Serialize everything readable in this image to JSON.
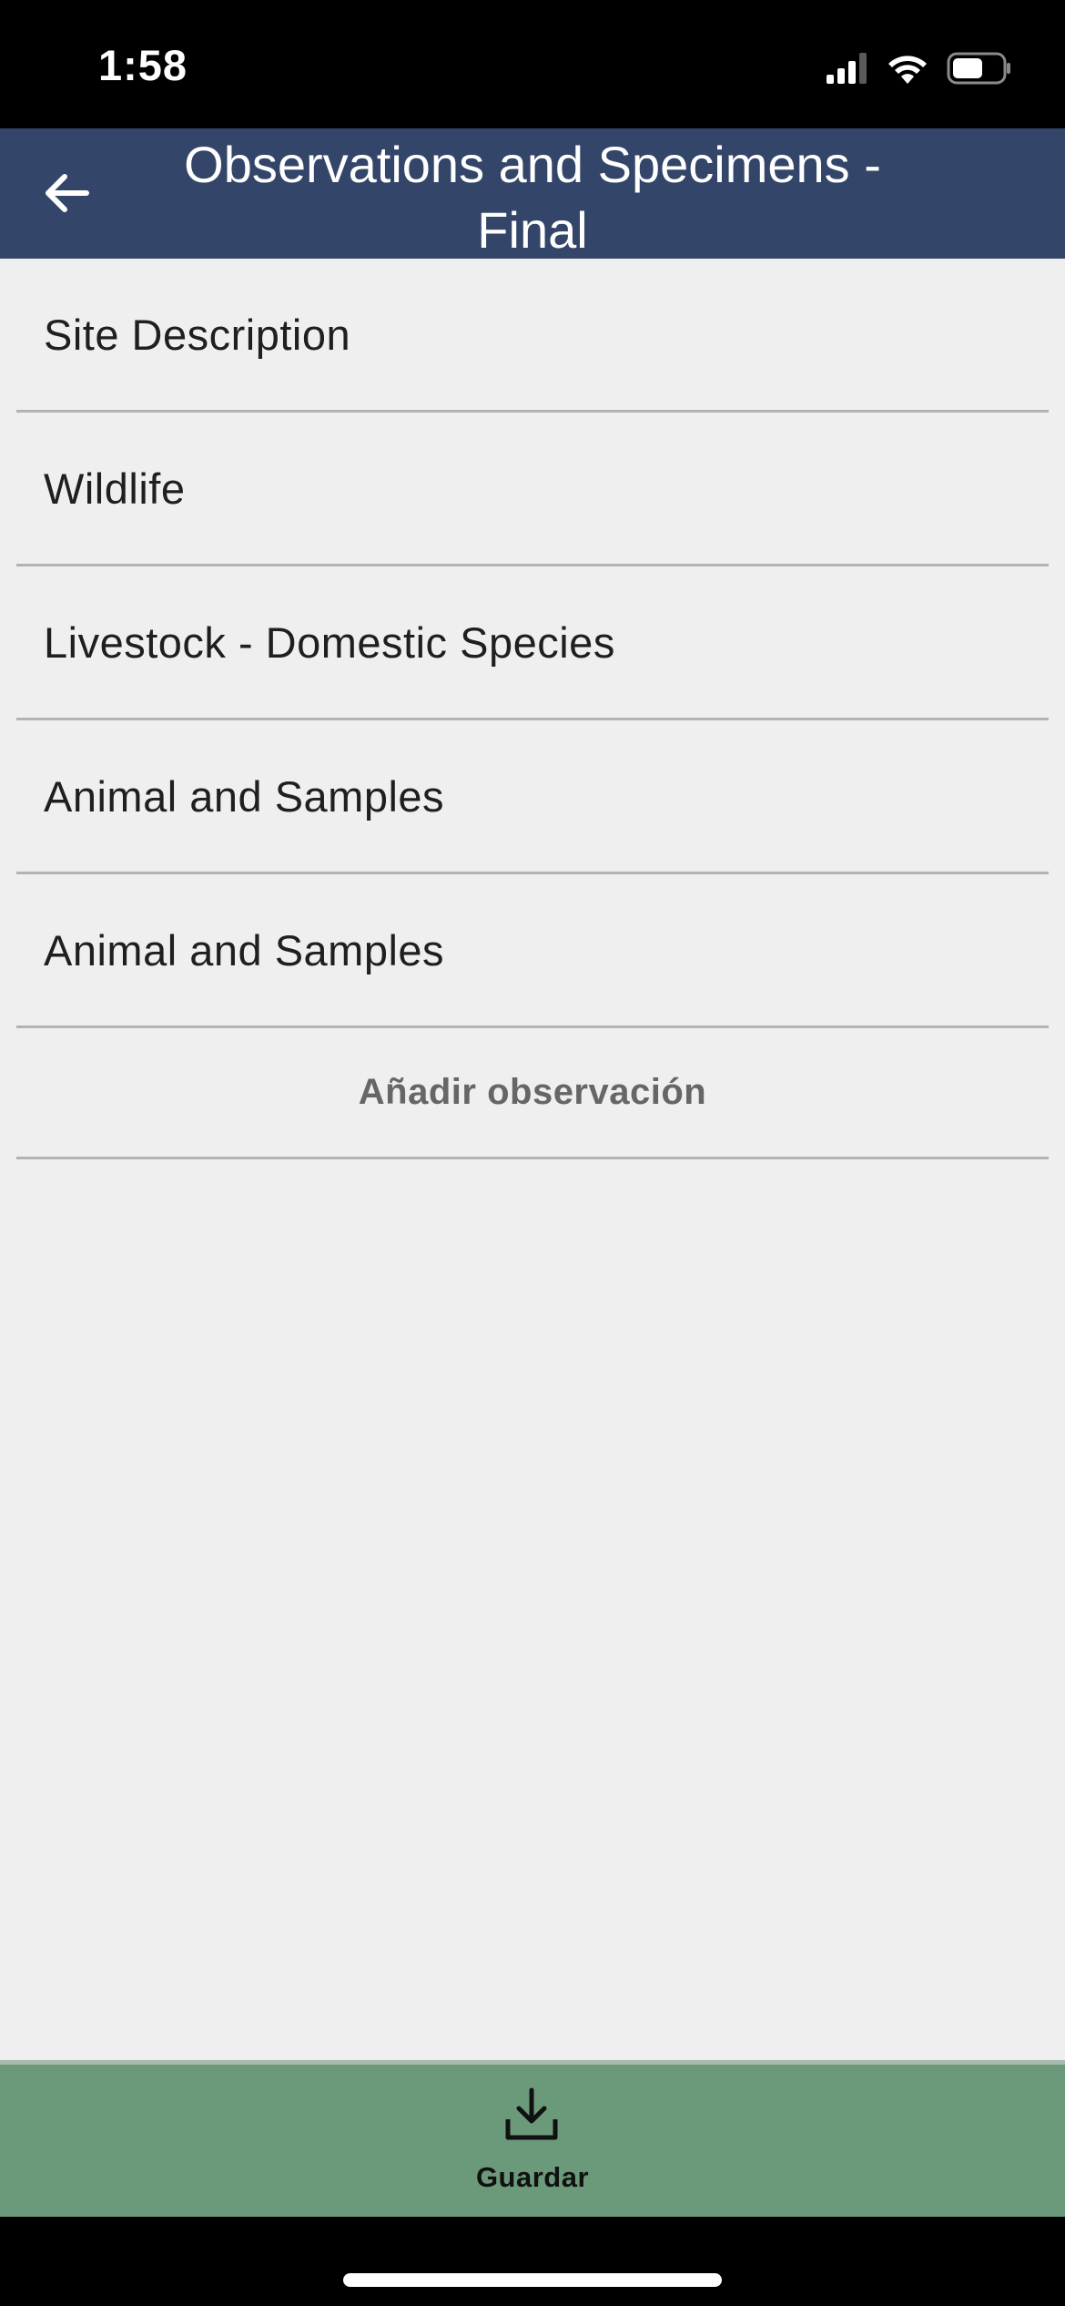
{
  "status_bar": {
    "time": "1:58",
    "icons": [
      "cellular-signal-icon",
      "wifi-icon",
      "battery-icon"
    ]
  },
  "header": {
    "title": "Observations and Specimens - Final",
    "background": "#33466a",
    "back_icon": "arrow-left-icon"
  },
  "observations": [
    {
      "label": "Site Description"
    },
    {
      "label": "Wildlife"
    },
    {
      "label": "Livestock - Domestic Species"
    },
    {
      "label": "Animal and Samples"
    },
    {
      "label": "Animal and Samples"
    }
  ],
  "add_observation": {
    "label": "Añadir observación"
  },
  "save": {
    "label": "Guardar",
    "icon": "download-tray-icon",
    "background": "#6b9a7a"
  }
}
